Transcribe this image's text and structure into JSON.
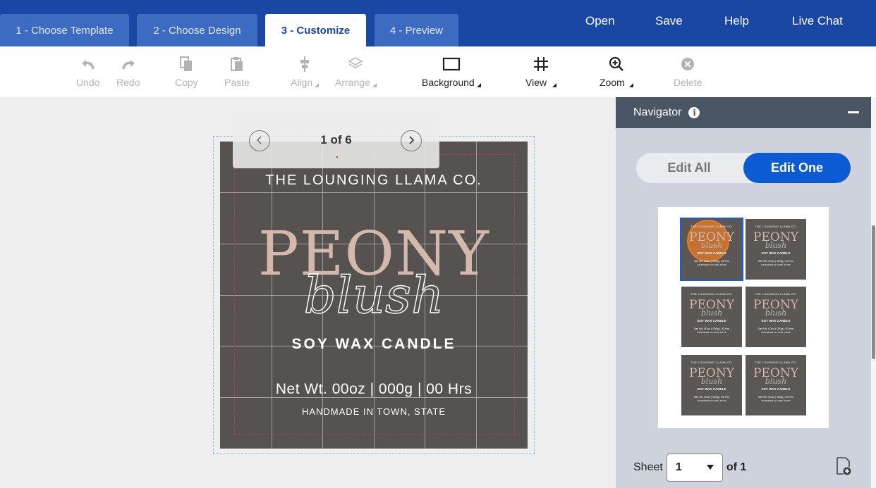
{
  "tabs": [
    {
      "label": "1 - Choose Template"
    },
    {
      "label": "2 - Choose Design"
    },
    {
      "label": "3 - Customize",
      "active": true
    },
    {
      "label": "4 - Preview"
    }
  ],
  "top_links": {
    "open": "Open",
    "save": "Save",
    "help": "Help",
    "live_chat": "Live Chat"
  },
  "toolbar": {
    "undo": "Undo",
    "redo": "Redo",
    "copy": "Copy",
    "paste": "Paste",
    "align": "Align",
    "arrange": "Arrange",
    "background": "Background",
    "view": "View",
    "zoom": "Zoom",
    "delete": "Delete"
  },
  "icons": {
    "undo": "undo-icon",
    "redo": "redo-icon",
    "copy": "copy-icon",
    "paste": "paste-icon",
    "align": "align-icon",
    "arrange": "layers-icon",
    "background": "rectangle-icon",
    "view": "grid-icon",
    "zoom": "zoom-in-icon",
    "delete": "delete-circle-icon",
    "info": "info-icon",
    "collapse": "minus-icon",
    "add_sheet": "add-page-icon",
    "prev": "chevron-left-icon",
    "next": "chevron-right-icon",
    "dropdown": "caret-down-icon"
  },
  "pager": {
    "text": "1 of 6"
  },
  "label": {
    "company": "THE LOUNGING LLAMA CO.",
    "title": "PEONY",
    "script": "blush",
    "product": "SOY WAX CANDLE",
    "weight": "Net Wt. 00oz | 000g | 00 Hrs",
    "origin": "HANDMADE IN TOWN, STATE"
  },
  "thumb_text": {
    "company": "THE LOUNGING LLAMA CO.",
    "title": "PEONY",
    "script": "blush",
    "product": "SOY WAX CANDLE",
    "weight": "Net Wt. 00oz | 000g | 00 Hrs",
    "origin": "HANDMADE IN TOWN, STATE"
  },
  "navigator": {
    "title": "Navigator",
    "edit_all": "Edit All",
    "edit_one": "Edit One",
    "sheet_label": "Sheet",
    "sheet_value": "1",
    "sheet_of": "of 1",
    "thumbnail_count": 6,
    "selected_thumbnail": 1
  },
  "colors": {
    "header_blue": "#1947a3",
    "tab_inactive": "#3e6bc2",
    "accent_blue": "#0c5bd3",
    "label_bg": "#55524f",
    "peony_pink": "#d4b8ab",
    "highlight_orange": "#e87a24",
    "navigator_header": "#4a5663"
  }
}
